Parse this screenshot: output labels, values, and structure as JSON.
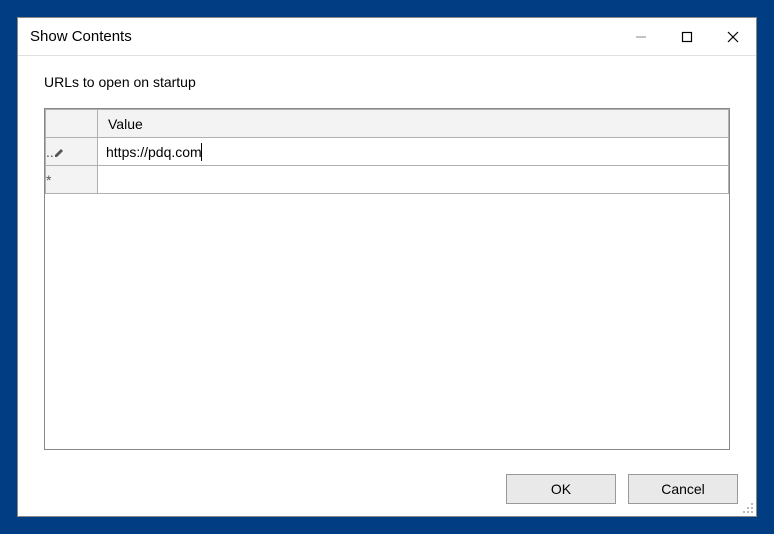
{
  "window": {
    "title": "Show Contents"
  },
  "form": {
    "label": "URLs to open on startup"
  },
  "grid": {
    "columns": {
      "value": "Value"
    },
    "rows": [
      {
        "indicator": "..✎",
        "value": "https://pdq.com",
        "editing": true
      },
      {
        "indicator": "*",
        "value": "",
        "editing": false
      }
    ]
  },
  "buttons": {
    "ok": "OK",
    "cancel": "Cancel"
  }
}
